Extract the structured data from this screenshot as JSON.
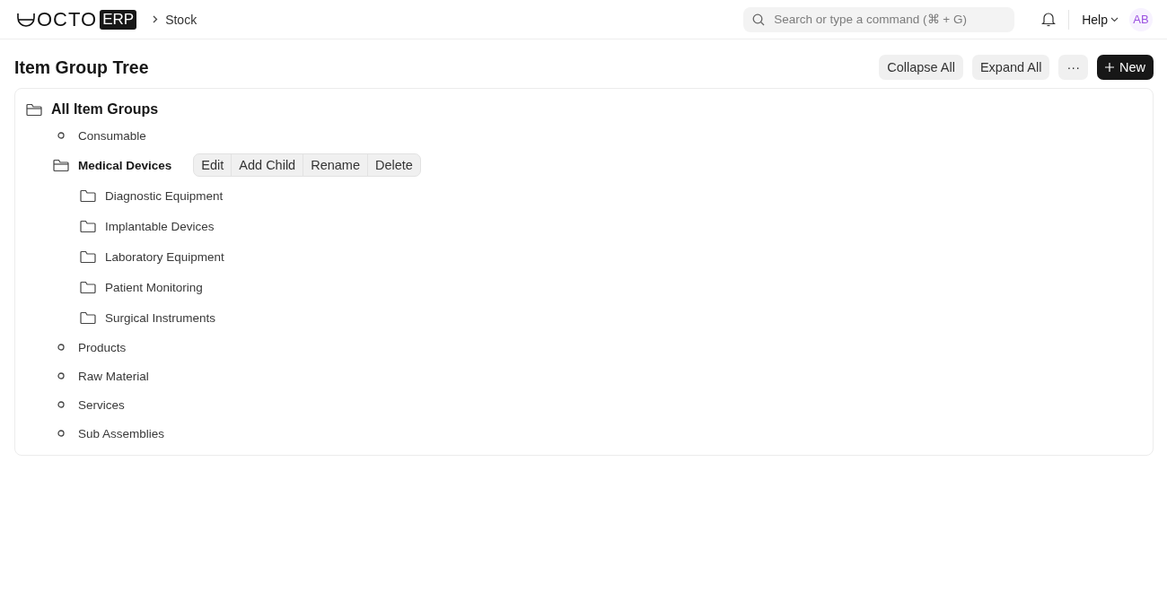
{
  "navbar": {
    "logo_text": "OCTO",
    "logo_badge": "ERP",
    "breadcrumbs": [
      "Stock"
    ],
    "search": {
      "placeholder": "Search or type a command (⌘ + G)"
    },
    "help": "Help",
    "avatar": "AB"
  },
  "page": {
    "title": "Item Group Tree",
    "buttons": [
      {
        "label": "Collapse All",
        "kind": "secondary"
      },
      {
        "label": "Expand All",
        "kind": "secondary"
      },
      {
        "label": "···",
        "kind": "secondary"
      },
      {
        "label": "New",
        "kind": "primary"
      }
    ]
  },
  "tree": {
    "node_actions": [
      "Edit",
      "Add Child",
      "Rename",
      "Delete"
    ],
    "root": {
      "label": "All Item Groups",
      "kind": "group",
      "expanded": true,
      "selected": false,
      "children": [
        {
          "label": "Consumable",
          "kind": "leaf",
          "selected": false
        },
        {
          "label": "Medical Devices",
          "kind": "group",
          "expanded": true,
          "selected": true,
          "children": [
            {
              "label": "Diagnostic Equipment",
              "kind": "group",
              "expanded": false,
              "selected": false
            },
            {
              "label": "Implantable Devices",
              "kind": "group",
              "expanded": false,
              "selected": false
            },
            {
              "label": "Laboratory Equipment",
              "kind": "group",
              "expanded": false,
              "selected": false
            },
            {
              "label": "Patient Monitoring",
              "kind": "group",
              "expanded": false,
              "selected": false
            },
            {
              "label": "Surgical Instruments",
              "kind": "group",
              "expanded": false,
              "selected": false
            }
          ]
        },
        {
          "label": "Products",
          "kind": "leaf",
          "selected": false
        },
        {
          "label": "Raw Material",
          "kind": "leaf",
          "selected": false
        },
        {
          "label": "Services",
          "kind": "leaf",
          "selected": false
        },
        {
          "label": "Sub Assemblies",
          "kind": "leaf",
          "selected": false
        }
      ]
    }
  }
}
